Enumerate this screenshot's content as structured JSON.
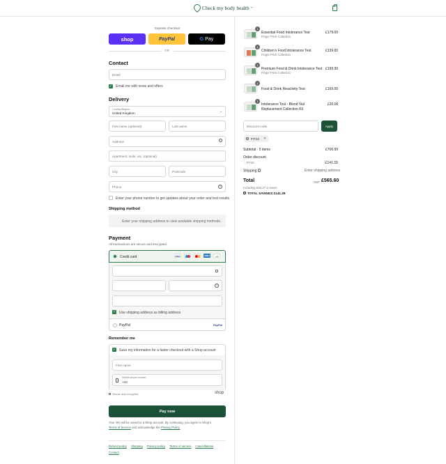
{
  "header": {
    "brand": "Check my body health",
    "tm": "™"
  },
  "express": {
    "label": "Express checkout",
    "shop": "shop",
    "paypal": "PayPal",
    "gpay_g": "G",
    "gpay": "Pay",
    "or": "OR"
  },
  "contact": {
    "title": "Contact",
    "email_placeholder": "Email",
    "news_label": "Email me with news and offers"
  },
  "delivery": {
    "title": "Delivery",
    "country_label": "Country/Region",
    "country_value": "United Kingdom",
    "first_name": "First name (optional)",
    "last_name": "Last name",
    "address": "Address",
    "apartment": "Apartment, suite, etc. (optional)",
    "city": "City",
    "postcode": "Postcode",
    "phone": "Phone",
    "sms_label": "Enter your phone number to get updates about your order and test results"
  },
  "shipping": {
    "title": "Shipping method",
    "info": "Enter your shipping address to view available shipping methods."
  },
  "payment": {
    "title": "Payment",
    "subtitle": "All transactions are secure and encrypted.",
    "credit_card": "Credit card",
    "card_brands": [
      "VISA",
      "",
      "",
      "AMEX"
    ],
    "more_brands": "+4",
    "billing_label": "Use shipping address as billing address",
    "paypal": "PayPal"
  },
  "remember": {
    "title": "Remember me",
    "save_label": "Save my information for a faster checkout with a Shop account",
    "first_name": "First name",
    "mobile_label": "Mobile phone number",
    "mobile_value": "+44",
    "secure": "Secure and encrypted",
    "shop": "shop"
  },
  "pay_now": "Pay now",
  "consent": {
    "line1": "Your info will be saved to a Shop account. By continuing, you agree to Shop's",
    "terms": "Terms of Service",
    "and": "and acknowledge the",
    "privacy": "Privacy Policy."
  },
  "footer_links": [
    "Refund policy",
    "Shipping",
    "Privacy policy",
    "Terms of service",
    "Cancellations",
    "Contact"
  ],
  "order": {
    "items": [
      {
        "qty": "1",
        "name": "Essential Food Intolerance Test",
        "sub": "Finger Prick Collection",
        "price": "£179.00"
      },
      {
        "qty": "1",
        "name": "Children's Food Intolerance Test",
        "sub": "Finger Prick Collection",
        "price": "£139.00"
      },
      {
        "qty": "1",
        "name": "Premium Food & Drink Intolerance Test",
        "sub": "Finger Prick Collection",
        "price": "£199.99"
      },
      {
        "qty": "1",
        "name": "Food & Drink Reactivity Test",
        "sub": "",
        "price": "£169.00"
      },
      {
        "qty": "1",
        "name": "Intolerance Test - Blood Vial Replacement Collection Kit",
        "sub": "",
        "price": "£20.00"
      }
    ],
    "discount_placeholder": "Discount code",
    "apply": "Apply",
    "code_tag": "FIT20",
    "subtotal_label": "Subtotal · 5 items",
    "subtotal": "£706.99",
    "order_discount_label": "Order discount",
    "discount_code": "FIT20",
    "discount_value": "-£141.39",
    "shipping_label": "Shipping",
    "shipping_value": "Enter shipping address",
    "total_label": "Total",
    "currency": "GBP",
    "total": "£565.60",
    "taxes": "Including £94.27 in taxes",
    "savings_label": "TOTAL SAVINGS",
    "savings": "£141.39"
  },
  "colors": {
    "accent": "#2b7a4b",
    "pay_button": "#1b5136",
    "shop": "#5a31f4",
    "paypal": "#ffc439"
  }
}
